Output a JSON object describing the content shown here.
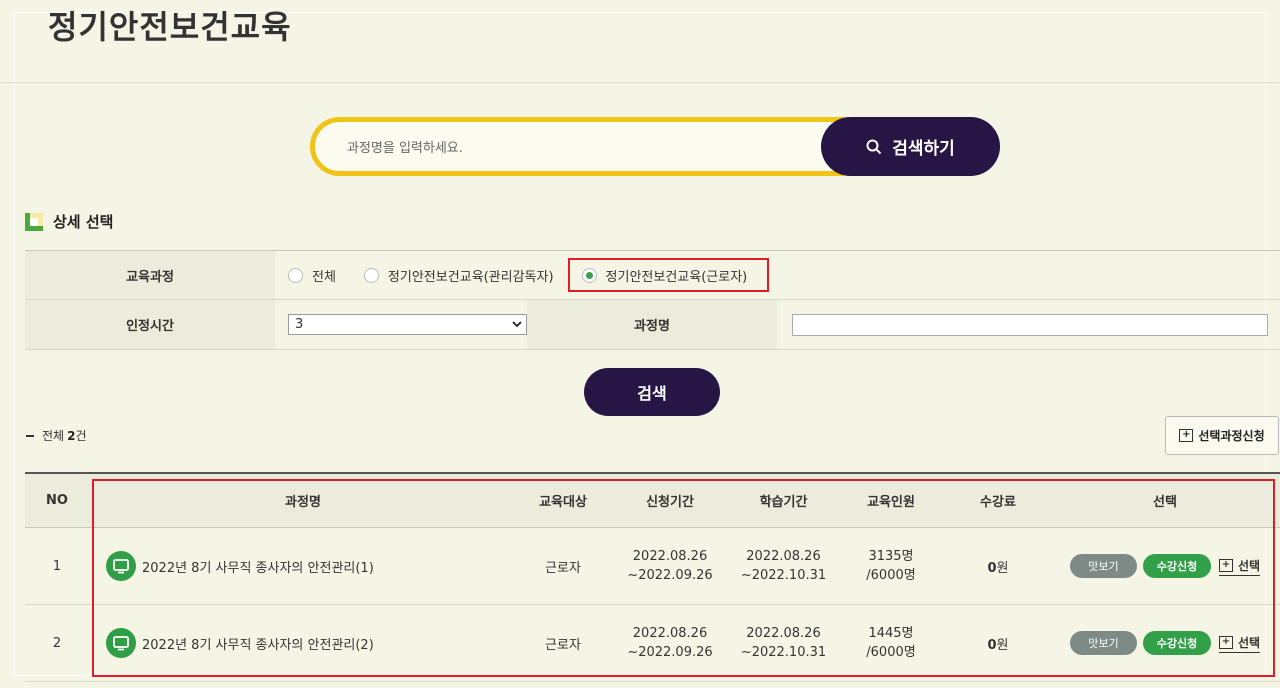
{
  "page": {
    "title": "정기안전보건교육"
  },
  "search": {
    "placeholder": "과정명을 입력하세요.",
    "button_label": "검색하기"
  },
  "detail": {
    "section_title": "상세 선택"
  },
  "filters": {
    "course_label": "교육과정",
    "course_options": [
      "전체",
      "정기안전보건교육(관리감독자)",
      "정기안전보건교육(근로자)"
    ],
    "course_selected": "정기안전보건교육(근로자)",
    "hours_label": "인정시간",
    "hours_value": "3",
    "name_label": "과정명",
    "name_value": ""
  },
  "search_button_label": "검색",
  "summary": {
    "prefix": "전체",
    "count": "2",
    "suffix": "건"
  },
  "apply_selected_label": "선택과정신청",
  "table": {
    "headers": [
      "NO",
      "과정명",
      "교육대상",
      "신청기간",
      "학습기간",
      "교육인원",
      "수강료",
      "선택"
    ],
    "rows": [
      {
        "no": "1",
        "name": "2022년 8기 사무직 종사자의 안전관리(1)",
        "target": "근로자",
        "apply_start": "2022.08.26",
        "apply_end": "~2022.09.26",
        "study_start": "2022.08.26",
        "study_end": "~2022.10.31",
        "people_current": "3135명",
        "people_max": "/6000명",
        "fee_amount": "0",
        "fee_unit": "원",
        "preview_label": "맛보기",
        "enroll_label": "수강신청",
        "select_label": "선택"
      },
      {
        "no": "2",
        "name": "2022년 8기 사무직 종사자의 안전관리(2)",
        "target": "근로자",
        "apply_start": "2022.08.26",
        "apply_end": "~2022.09.26",
        "study_start": "2022.08.26",
        "study_end": "~2022.10.31",
        "people_current": "1445명",
        "people_max": "/6000명",
        "fee_amount": "0",
        "fee_unit": "원",
        "preview_label": "맛보기",
        "enroll_label": "수강신청",
        "select_label": "선택"
      }
    ]
  },
  "colors": {
    "accent_yellow": "#f0c417",
    "button_dark": "#271545",
    "green": "#32a048",
    "highlight_red": "#e01b2a"
  }
}
